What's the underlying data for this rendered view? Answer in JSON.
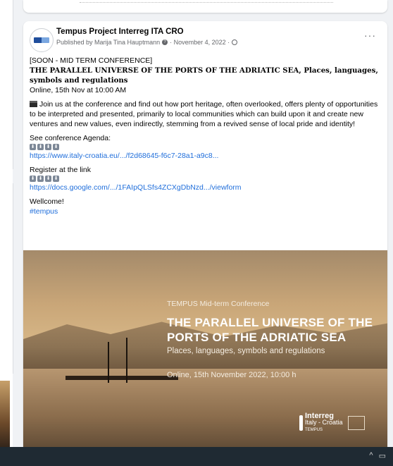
{
  "post": {
    "page_name": "Tempus Project Interreg ITA CRO",
    "published_by": "Published by Marija Tina Hauptmann",
    "date": "· November 4, 2022 ·",
    "more_label": "···",
    "line_soon": "[SOON - MID TERM CONFERENCE]",
    "line_title": "THE PARALLEL UNIVERSE OF THE PORTS OF THE ADRIATIC SEA, Places, languages, symbols and regulations",
    "line_online": "Online, 15th Nov at 10:00 AM",
    "body": "Join us at the conference and find out how port heritage, often overlooked, offers plenty of opportunities to be interpreted and presented, primarily to local communities which can build upon it and create new ventures and new values, even indirectly, stemming from a revived sense of local pride and identity!",
    "agenda_label": "See conference Agenda:",
    "agenda_link": " https://www.italy-croatia.eu/.../f2d68645-f6c7-28a1-a9c8...",
    "register_label": "Register at the link",
    "register_link": "https://docs.google.com/.../1FAIpQLSfs4ZCXgDbNzd.../viewform",
    "wellcome": "Wellcome!",
    "hashtag": "#tempus"
  },
  "banner": {
    "subtitle": "TEMPUS Mid-term Conference",
    "title": "THE PARALLEL UNIVERSE OF THE PORTS OF THE ADRIATIC SEA",
    "places": "Places, languages, symbols and regulations",
    "date": "Online, 15th November 2022,  10:00 h",
    "logo_main": "Interreg",
    "logo_sub": "Italy - Croatia",
    "logo_project": "TEMPUS"
  },
  "taskbar": {
    "chevron_icon": "chevron-up-icon",
    "notifications_icon": "notifications-icon"
  },
  "colors": {
    "link": "#216fdb",
    "secondary_text": "#65676b",
    "page_bg": "#f0f2f5"
  }
}
